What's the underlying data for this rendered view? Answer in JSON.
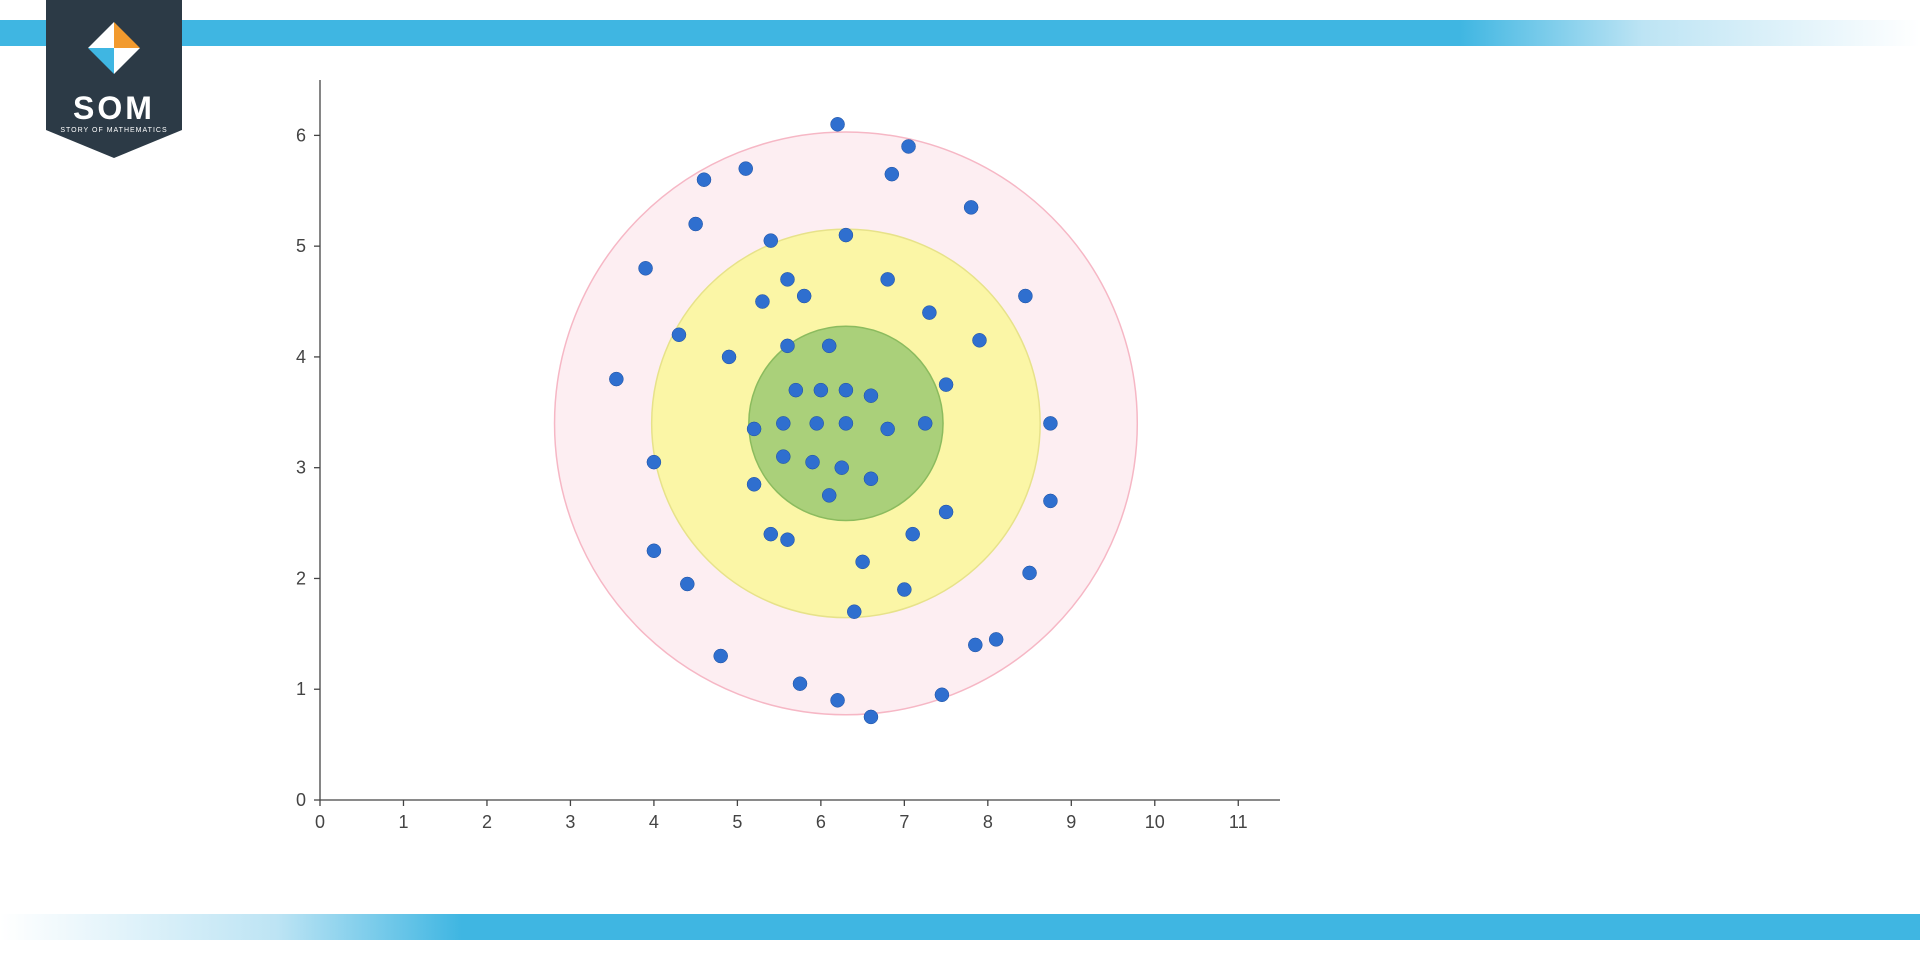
{
  "brand": {
    "name": "SOM",
    "tagline": "STORY OF MATHEMATICS"
  },
  "chart_data": {
    "type": "scatter",
    "xlim": [
      0,
      11.5
    ],
    "ylim": [
      0,
      6.5
    ],
    "x_ticks": [
      0,
      1,
      2,
      3,
      4,
      5,
      6,
      7,
      8,
      9,
      10,
      11
    ],
    "y_ticks": [
      0,
      1,
      2,
      3,
      4,
      5,
      6
    ],
    "title": "",
    "xlabel": "",
    "ylabel": "",
    "circles": [
      {
        "cx": 6.3,
        "cy": 3.4,
        "r": 3.0,
        "fill": "#fdeef2",
        "stroke": "#f6b7c5"
      },
      {
        "cx": 6.3,
        "cy": 3.4,
        "r": 2.0,
        "fill": "#fbf6a6",
        "stroke": "#e7e28a"
      },
      {
        "cx": 6.3,
        "cy": 3.4,
        "r": 1.0,
        "fill": "#aad07a",
        "stroke": "#8bbb5e"
      }
    ],
    "series": [
      {
        "name": "points",
        "color": "#2f6fcf",
        "points": [
          [
            3.55,
            3.8
          ],
          [
            3.9,
            4.8
          ],
          [
            4.0,
            2.25
          ],
          [
            4.0,
            3.05
          ],
          [
            4.3,
            4.2
          ],
          [
            4.4,
            1.95
          ],
          [
            4.5,
            5.2
          ],
          [
            4.6,
            5.6
          ],
          [
            4.8,
            1.3
          ],
          [
            4.9,
            4.0
          ],
          [
            5.1,
            5.7
          ],
          [
            5.2,
            2.85
          ],
          [
            5.2,
            3.35
          ],
          [
            5.3,
            4.5
          ],
          [
            5.4,
            2.4
          ],
          [
            5.4,
            5.05
          ],
          [
            5.55,
            3.1
          ],
          [
            5.55,
            3.4
          ],
          [
            5.6,
            2.35
          ],
          [
            5.6,
            4.1
          ],
          [
            5.6,
            4.7
          ],
          [
            5.7,
            3.7
          ],
          [
            5.75,
            1.05
          ],
          [
            5.8,
            4.55
          ],
          [
            5.9,
            3.05
          ],
          [
            5.95,
            3.4
          ],
          [
            6.0,
            3.7
          ],
          [
            6.1,
            2.75
          ],
          [
            6.1,
            4.1
          ],
          [
            6.2,
            0.9
          ],
          [
            6.2,
            6.1
          ],
          [
            6.25,
            3.0
          ],
          [
            6.3,
            3.4
          ],
          [
            6.3,
            3.7
          ],
          [
            6.3,
            5.1
          ],
          [
            6.4,
            1.7
          ],
          [
            6.5,
            2.15
          ],
          [
            6.6,
            0.75
          ],
          [
            6.6,
            2.9
          ],
          [
            6.6,
            3.65
          ],
          [
            6.8,
            3.35
          ],
          [
            6.8,
            4.7
          ],
          [
            6.85,
            5.65
          ],
          [
            7.0,
            1.9
          ],
          [
            7.05,
            5.9
          ],
          [
            7.1,
            2.4
          ],
          [
            7.25,
            3.4
          ],
          [
            7.3,
            4.4
          ],
          [
            7.45,
            0.95
          ],
          [
            7.5,
            2.6
          ],
          [
            7.5,
            3.75
          ],
          [
            7.8,
            5.35
          ],
          [
            7.85,
            1.4
          ],
          [
            7.9,
            4.15
          ],
          [
            8.1,
            1.45
          ],
          [
            8.45,
            4.55
          ],
          [
            8.5,
            2.05
          ],
          [
            8.75,
            2.7
          ],
          [
            8.75,
            3.4
          ]
        ]
      }
    ]
  }
}
